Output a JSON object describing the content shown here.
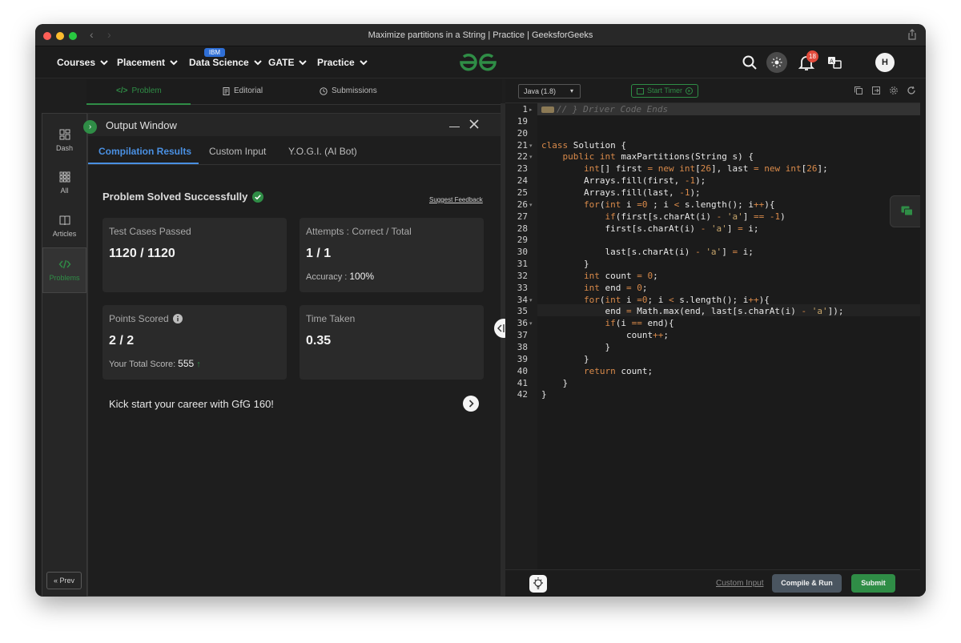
{
  "window": {
    "title": "Maximize partitions in a String | Practice | GeeksforGeeks"
  },
  "navbar": {
    "items": [
      {
        "label": "Courses"
      },
      {
        "label": "Placement"
      },
      {
        "label": "Data Science"
      },
      {
        "label": "GATE"
      },
      {
        "label": "Practice"
      }
    ],
    "data_science_badge": "IBM",
    "notification_count": "18",
    "avatar_initial": "H"
  },
  "problem_tabs": [
    {
      "label": "Problem",
      "icon": "code-icon"
    },
    {
      "label": "Editorial",
      "icon": "document-icon"
    },
    {
      "label": "Submissions",
      "icon": "clock-icon"
    }
  ],
  "sidenav": {
    "items": [
      {
        "label": "Dash",
        "icon": "dashboard-icon"
      },
      {
        "label": "All",
        "icon": "grid-icon"
      },
      {
        "label": "Articles",
        "icon": "book-icon"
      },
      {
        "label": "Problems",
        "icon": "code-icon"
      }
    ],
    "prev_label": "Prev"
  },
  "output": {
    "title": "Output Window",
    "tabs": [
      {
        "label": "Compilation Results"
      },
      {
        "label": "Custom Input"
      },
      {
        "label": "Y.O.G.I. (AI Bot)"
      }
    ],
    "status": "Problem Solved Successfully",
    "feedback_link": "Suggest Feedback",
    "cards": {
      "test_cases": {
        "label": "Test Cases Passed",
        "value": "1120 / 1120"
      },
      "attempts": {
        "label": "Attempts : Correct / Total",
        "value": "1 / 1",
        "sub_label": "Accuracy :",
        "sub_value": "100%"
      },
      "points": {
        "label": "Points Scored",
        "value": "2 / 2",
        "sub_label": "Your Total Score:",
        "sub_value": "555"
      },
      "time": {
        "label": "Time Taken",
        "value": "0.35"
      }
    },
    "kickstart": "Kick start your career with GfG 160!"
  },
  "editor": {
    "language": "Java (1.8)",
    "timer_label": "Start Timer",
    "custom_input": "Custom Input",
    "compile_label": "Compile & Run",
    "submit_label": "Submit",
    "line_numbers": [
      "1",
      "19",
      "20",
      "21",
      "22",
      "23",
      "24",
      "25",
      "26",
      "27",
      "28",
      "29",
      "30",
      "31",
      "32",
      "33",
      "34",
      "35",
      "36",
      "37",
      "38",
      "39",
      "40",
      "41",
      "42"
    ],
    "folded_comment": "// } Driver Code Ends",
    "code_lines": [
      "",
      "",
      "",
      "class Solution {",
      "    public int maxPartitions(String s) {",
      "        int[] first = new int[26], last = new int[26];",
      "        Arrays.fill(first, -1);",
      "        Arrays.fill(last, -1);",
      "        for(int i =0 ; i < s.length(); i++){",
      "            if(first[s.charAt(i) - 'a'] == -1)",
      "            first[s.charAt(i) - 'a'] = i;",
      "",
      "            last[s.charAt(i) - 'a'] = i;",
      "        }",
      "        int count = 0;",
      "        int end = 0;",
      "        for(int i =0; i < s.length(); i++){",
      "            end = Math.max(end, last[s.charAt(i) - 'a']);",
      "            if(i == end){",
      "                count++;",
      "            }",
      "        }",
      "        return count;",
      "    }",
      "}"
    ]
  }
}
